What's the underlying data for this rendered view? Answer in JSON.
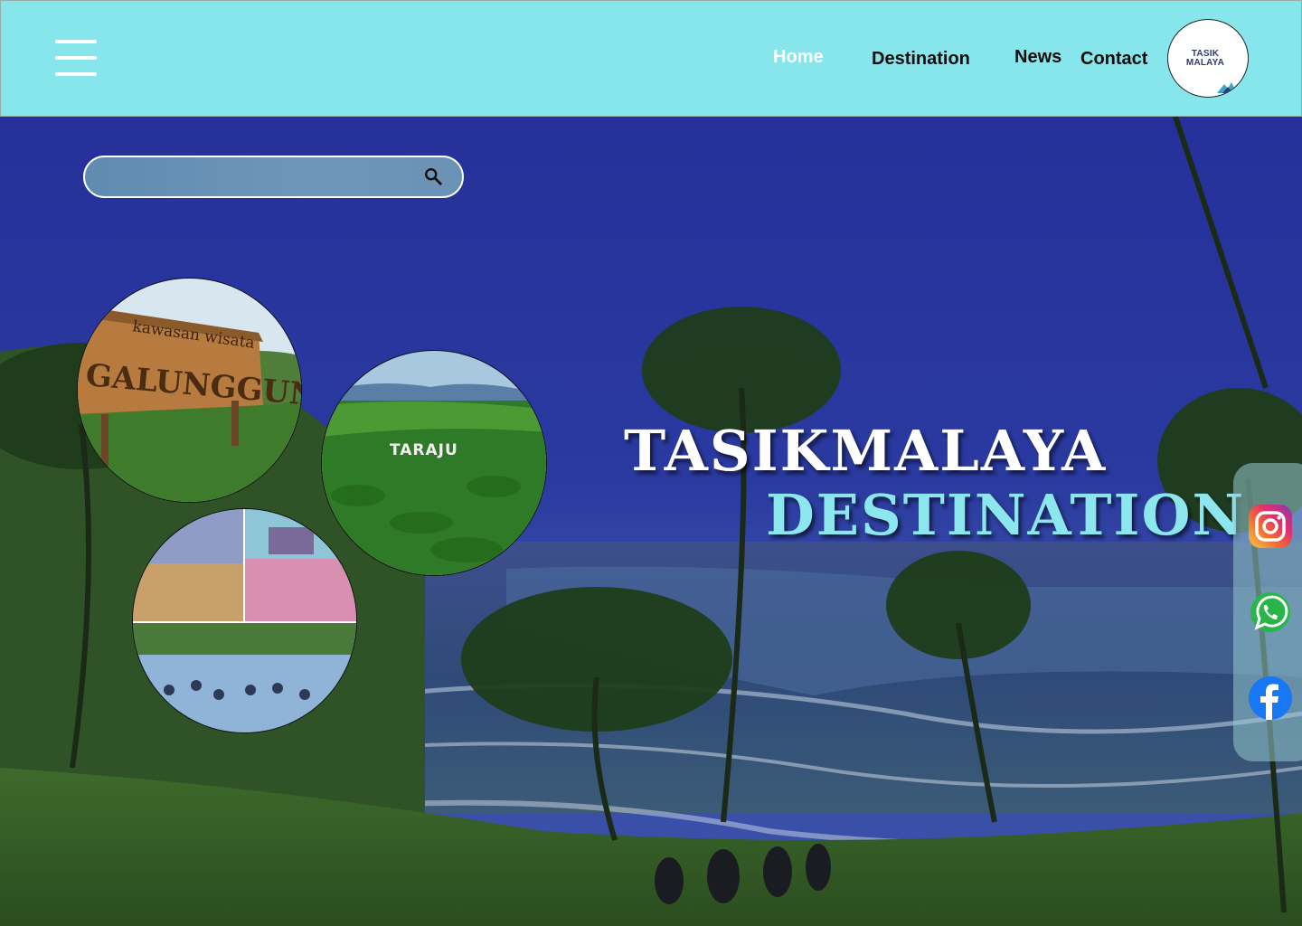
{
  "nav": {
    "items": [
      {
        "id": "home",
        "label": "Home",
        "active": true
      },
      {
        "id": "destination",
        "label": "Destination",
        "active": false
      },
      {
        "id": "news",
        "label": "News",
        "active": false
      },
      {
        "id": "contact",
        "label": "Contact",
        "active": false
      }
    ],
    "logo": {
      "line1": "TASIK",
      "line2": "MALAYA"
    }
  },
  "search": {
    "value": "",
    "placeholder": ""
  },
  "hero": {
    "title_line1": "TASIKMALAYA",
    "title_line2": "DESTINATION"
  },
  "photos": {
    "galunggung": {
      "sign_small": "kawasan wisata",
      "sign_big": "GALUNGGUNG"
    },
    "taraju": {
      "sign": "TARAJU"
    }
  },
  "social": [
    "instagram-icon",
    "whatsapp-icon",
    "facebook-icon"
  ],
  "colors": {
    "header_bg": "#86e6ec",
    "active_nav": "#ffffff",
    "title_primary": "#ffffff",
    "title_accent": "#8ce6ee"
  }
}
